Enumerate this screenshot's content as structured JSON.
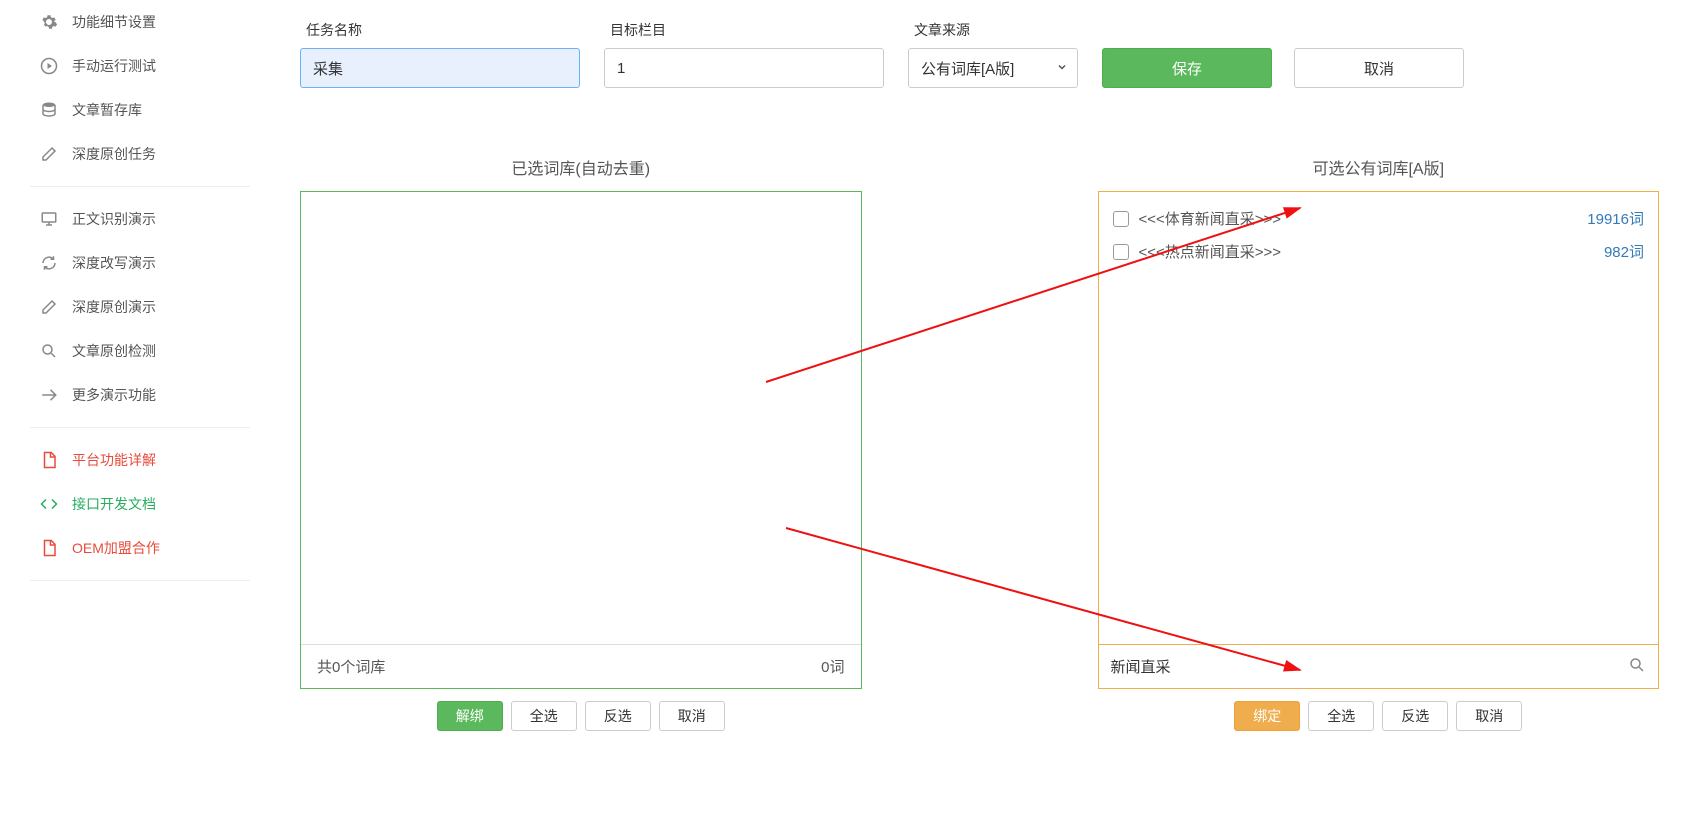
{
  "sidebar": {
    "items": [
      {
        "label": "功能细节设置",
        "icon": "cogs"
      },
      {
        "label": "手动运行测试",
        "icon": "play"
      },
      {
        "label": "文章暂存库",
        "icon": "database"
      },
      {
        "label": "深度原创任务",
        "icon": "edit"
      }
    ],
    "demo_items": [
      {
        "label": "正文识别演示",
        "icon": "monitor"
      },
      {
        "label": "深度改写演示",
        "icon": "refresh"
      },
      {
        "label": "深度原创演示",
        "icon": "edit"
      },
      {
        "label": "文章原创检测",
        "icon": "search"
      },
      {
        "label": "更多演示功能",
        "icon": "share"
      }
    ],
    "doc_items": [
      {
        "label": "平台功能详解",
        "icon": "file",
        "cls": "red"
      },
      {
        "label": "接口开发文档",
        "icon": "code",
        "cls": "green"
      },
      {
        "label": "OEM加盟合作",
        "icon": "file",
        "cls": "red"
      }
    ]
  },
  "form": {
    "task_name_label": "任务名称",
    "task_name_value": "采集",
    "target_label": "目标栏目",
    "target_value": "1",
    "source_label": "文章来源",
    "source_value": "公有词库[A版]",
    "save_label": "保存",
    "cancel_label": "取消"
  },
  "left_panel": {
    "title": "已选词库(自动去重)",
    "footer_left": "共0个词库",
    "footer_right": "0词",
    "buttons": {
      "unbind": "解绑",
      "select_all": "全选",
      "invert": "反选",
      "cancel": "取消"
    }
  },
  "right_panel": {
    "title": "可选公有词库[A版]",
    "items": [
      {
        "label": "<<<体育新闻直采>>>",
        "count": "19916词"
      },
      {
        "label": "<<<热点新闻直采>>>",
        "count": "982词"
      }
    ],
    "search_value": "新闻直采",
    "buttons": {
      "bind": "绑定",
      "select_all": "全选",
      "invert": "反选",
      "cancel": "取消"
    }
  }
}
